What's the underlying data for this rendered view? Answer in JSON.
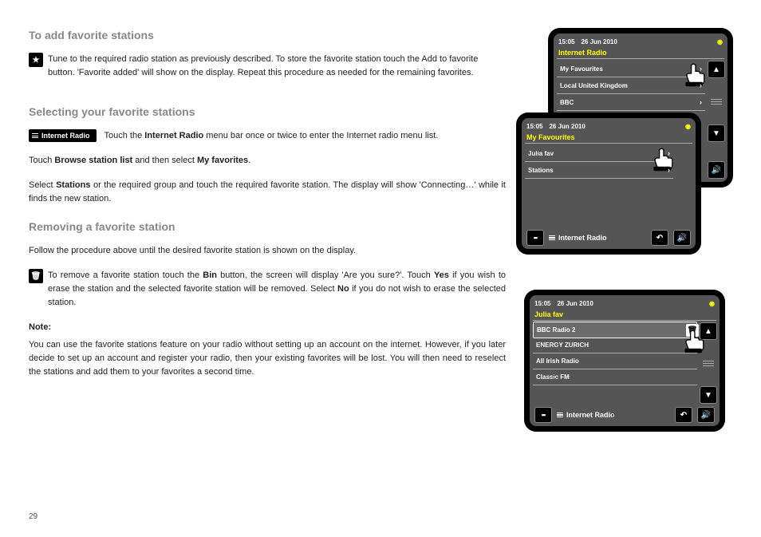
{
  "page_number": "29",
  "headings": {
    "add": "To add favorite stations",
    "select": "Selecting your favorite stations",
    "remove": "Removing a favorite station"
  },
  "text": {
    "add_p1": "Tune to the required radio station as previously described. To store the favorite station touch the Add to favorite button. 'Favorite added' will show on the display. Repeat this procedure as needed for the remaining favorites.",
    "select_p1a": "Touch the ",
    "select_p1b": "Internet Radio",
    "select_p1c": " menu bar once or twice to enter the Internet radio menu list.",
    "select_p2a": "Touch ",
    "select_p2b": "Browse station list",
    "select_p2c": " and then select ",
    "select_p2d": "My favorites",
    "select_p2e": ".",
    "select_p3a": "Select ",
    "select_p3b": "Stations",
    "select_p3c": " or the required group and touch the required favorite station. The display will show 'Connecting…' while it finds the new station.",
    "remove_p1": "Follow the procedure above until the desired favorite station is shown on the display.",
    "remove_p2a": "To remove a favorite station touch the ",
    "remove_p2b": "Bin",
    "remove_p2c": " button, the screen will display 'Are you sure?'. Touch ",
    "remove_p2d": "Yes",
    "remove_p2e": " if you wish to erase the station and the selected favorite station will be removed. Select ",
    "remove_p2f": "No",
    "remove_p2g": " if you do not wish to erase the selected station.",
    "note_label": "Note:",
    "note_body": "You can use the favorite stations feature on your radio without setting up an account on the internet. However, if you later decide to set up an account and register your radio, then your existing favorites will be lost. You will then need to reselect the stations and add them to your favorites a second time."
  },
  "chip": {
    "star": "★",
    "bin": "🗑",
    "internet_radio": "Internet Radio"
  },
  "screens": {
    "s1": {
      "time": "15:05",
      "date": "26 Jun 2010",
      "title": "Internet Radio",
      "rows": [
        "My Favourites",
        "Local United Kingdom",
        "BBC"
      ]
    },
    "s2": {
      "time": "15:05",
      "date": "26 Jun 2010",
      "title": "My Favourites",
      "rows": [
        "Julia fav",
        "Stations"
      ],
      "bottom": "Internet Radio"
    },
    "s3": {
      "time": "15:05",
      "date": "26 Jun 2010",
      "title": "Julia fav",
      "rows": [
        "BBC Radio 2",
        "ENERGY ZURICH",
        "All Irish Radio",
        "Classic FM"
      ],
      "bottom": "Internet Radio"
    }
  }
}
